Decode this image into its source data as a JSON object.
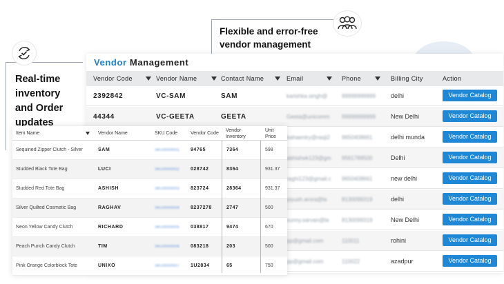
{
  "callouts": {
    "flexible": {
      "line1": "Flexible and error-free",
      "line2": "vendor management",
      "icon": "people-group-icon"
    },
    "realtime": {
      "line1": "Real-time",
      "line2": "inventory",
      "line3": "and Order",
      "line4": "updates",
      "icon": "sync-check-icon"
    }
  },
  "vendor_panel": {
    "title_part1": "Vendor",
    "title_part2": "Management",
    "columns": [
      "Vendor Code",
      "Vendor Name",
      "Contact Name",
      "Email",
      "Phone",
      "Billing City",
      "Action"
    ],
    "rows": [
      {
        "code": "2392842",
        "name": "VC-SAM",
        "contact": "SAM",
        "email": "karishka.singh@",
        "phone": "99999999999",
        "city": "delhi",
        "action": "Vendor Catalog"
      },
      {
        "code": "44344",
        "name": "VC-GEETA",
        "contact": "GEETA",
        "email": "Geeta@unicomm",
        "phone": "99999999999",
        "city": "New Delhi",
        "action": "Vendor Catalog"
      },
      {
        "code": "",
        "name": "",
        "contact": "",
        "email": "bahaentry@rasji2",
        "phone": "9650408661",
        "city": "delhi munda",
        "action": "Vendor Catalog"
      },
      {
        "code": "",
        "name": "",
        "contact": "",
        "email": "abhishek123@gm",
        "phone": "9561789500",
        "city": "Delhi",
        "action": "Vendor Catalog"
      },
      {
        "code": "",
        "name": "",
        "contact": "",
        "email": "raghi123@gmail.c",
        "phone": "9650408661",
        "city": "new delhi",
        "action": "Vendor Catalog"
      },
      {
        "code": "",
        "name": "",
        "contact": "",
        "email": "piyush.arora@la",
        "phone": "8130099319",
        "city": "delhi",
        "action": "Vendor Catalog"
      },
      {
        "code": "",
        "name": "",
        "contact": "",
        "email": "sunny.sarvan@la",
        "phone": "8130099319",
        "city": "New Delhi",
        "action": "Vendor Catalog"
      },
      {
        "code": "",
        "name": "",
        "contact": "",
        "email": "pp@gmail.com",
        "phone": "110011",
        "city": "rohini",
        "action": "Vendor Catalog"
      },
      {
        "code": "",
        "name": "",
        "contact": "",
        "email": "pp@gmail.com",
        "phone": "110022",
        "city": "azadpur",
        "action": "Vendor Catalog"
      }
    ]
  },
  "item_panel": {
    "columns": {
      "item": "Item Name",
      "vendor": "Vendor Name",
      "sku": "SKU Code",
      "vcode": "Vendor Code",
      "inv1": "Vendor",
      "inv2": "Inventory",
      "price1": "Unit",
      "price2": "Price"
    },
    "rows": [
      {
        "item": "Sequined Zipper Clutch - Silver",
        "vendor": "SAM",
        "sku": "SKU0000001",
        "vcode": "94765",
        "inventory": "7364",
        "price": "598"
      },
      {
        "item": "Studded Black Tote Bag",
        "vendor": "LUCI",
        "sku": "SKU0000002",
        "vcode": "028742",
        "inventory": "8364",
        "price": "931.37"
      },
      {
        "item": "Studded Red Tote Bag",
        "vendor": "ASHISH",
        "sku": "SKU0000003",
        "vcode": "823724",
        "inventory": "28364",
        "price": "931.37"
      },
      {
        "item": "Silver Quilted Cosmetic Bag",
        "vendor": "RAGHAV",
        "sku": "SKU0000004",
        "vcode": "8237278",
        "inventory": "2747",
        "price": "500"
      },
      {
        "item": "Neon Yellow Candy Clutch",
        "vendor": "RICHARD",
        "sku": "SKU0000005",
        "vcode": "038817",
        "inventory": "9474",
        "price": "670"
      },
      {
        "item": "Peach Punch Candy Clutch",
        "vendor": "TIM",
        "sku": "SKU0000006",
        "vcode": "083218",
        "inventory": "203",
        "price": "500"
      },
      {
        "item": "Pink Orange Colorblock Tote",
        "vendor": "UNIXO",
        "sku": "SKU0000007",
        "vcode": "1U2834",
        "inventory": "65",
        "price": "750"
      }
    ]
  },
  "colors": {
    "accent": "#1a7fd0",
    "button": "#1e88d6",
    "header_bg": "#e8e9eb"
  }
}
